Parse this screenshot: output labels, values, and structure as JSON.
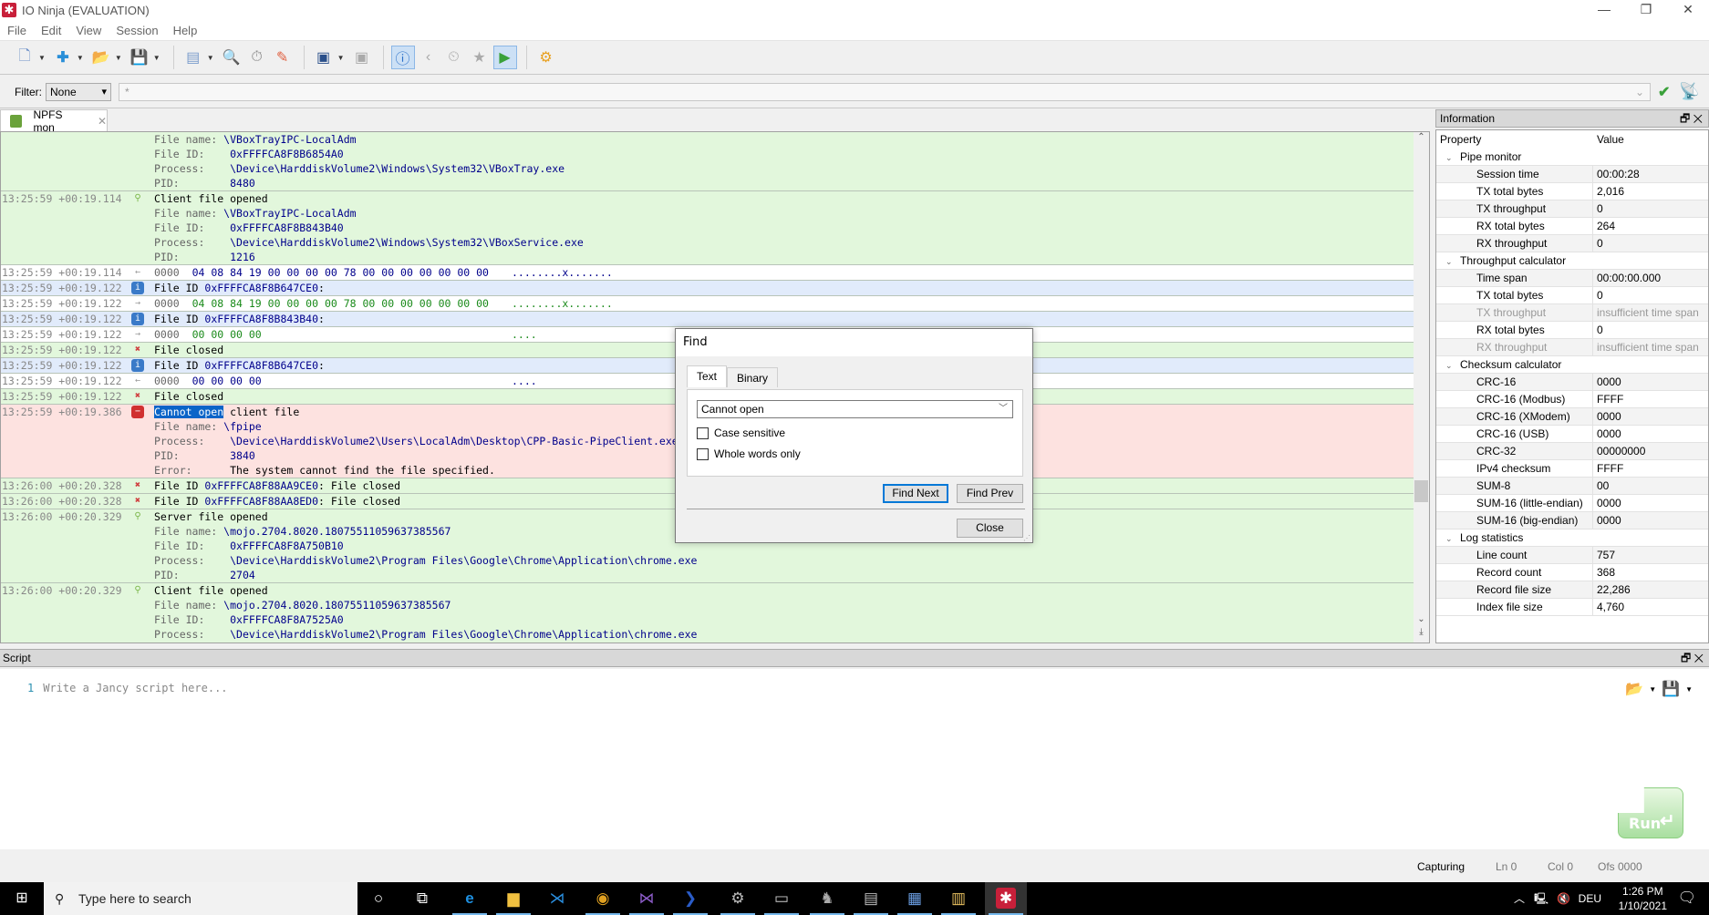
{
  "window": {
    "title": "IO Ninja (EVALUATION)",
    "minimize": "—",
    "restore": "❐",
    "close": "✕"
  },
  "menu": [
    "File",
    "Edit",
    "View",
    "Session",
    "Help"
  ],
  "toolbar": {
    "icons": [
      "new-session-icon",
      "add-icon",
      "open-icon",
      "save-icon",
      "hex-view-icon",
      "find-icon",
      "stopwatch-icon",
      "clear-icon",
      "terminal-icon",
      "terminal-disabled-icon",
      "info-panel-icon",
      "previous-icon",
      "stopwatch-panel-icon",
      "bookmark-icon",
      "play-icon",
      "settings-icon"
    ]
  },
  "filter": {
    "label": "Filter:",
    "mode": "None",
    "value": "*"
  },
  "tabs": [
    {
      "label": "NPFS mon",
      "close": "✕"
    }
  ],
  "log": {
    "rows": [
      {
        "ts": "",
        "icon": "",
        "bg": "green",
        "lines": [
          {
            "k": "File name: ",
            "v": "\\VBoxTrayIPC-LocalAdm"
          },
          {
            "k": "File ID:    ",
            "v": "0xFFFFCA8F8B6854A0"
          },
          {
            "k": "Process:    ",
            "v": "\\Device\\HarddiskVolume2\\Windows\\System32\\VBoxTray.exe"
          },
          {
            "k": "PID:        ",
            "v": "8480"
          }
        ]
      },
      {
        "ts": "13:25:59 +00:19.114",
        "icon": "connect",
        "bg": "green",
        "lines": [
          {
            "t": "Client file opened"
          },
          {
            "k": "File name: ",
            "v": "\\VBoxTrayIPC-LocalAdm"
          },
          {
            "k": "File ID:    ",
            "v": "0xFFFFCA8F8B843B40"
          },
          {
            "k": "Process:    ",
            "v": "\\Device\\HarddiskVolume2\\Windows\\System32\\VBoxService.exe"
          },
          {
            "k": "PID:        ",
            "v": "1216"
          }
        ]
      },
      {
        "ts": "13:25:59 +00:19.114",
        "icon": "rx",
        "bg": "white",
        "lines": [
          {
            "off": "0000",
            "hex": "04 08 84 19 00 00 00 00 78 00 00 00 00 00 00 00",
            "asc": "........x.......",
            "dir": "rx"
          }
        ]
      },
      {
        "ts": "13:25:59 +00:19.122",
        "icon": "info",
        "bg": "blue",
        "lines": [
          {
            "t": "File ID ",
            "v": "0xFFFFCA8F8B647CE0",
            "t2": ":"
          }
        ]
      },
      {
        "ts": "13:25:59 +00:19.122",
        "icon": "tx",
        "bg": "white",
        "lines": [
          {
            "off": "0000",
            "hex": "04 08 84 19 00 00 00 00 78 00 00 00 00 00 00 00",
            "asc": "........x.......",
            "dir": "tx"
          }
        ]
      },
      {
        "ts": "13:25:59 +00:19.122",
        "icon": "info",
        "bg": "blue",
        "lines": [
          {
            "t": "File ID ",
            "v": "0xFFFFCA8F8B843B40",
            "t2": ":"
          }
        ]
      },
      {
        "ts": "13:25:59 +00:19.122",
        "icon": "tx",
        "bg": "white",
        "lines": [
          {
            "off": "0000",
            "hex": "00 00 00 00",
            "asc": "....",
            "dir": "tx"
          }
        ]
      },
      {
        "ts": "13:25:59 +00:19.122",
        "icon": "disconnect",
        "bg": "green",
        "lines": [
          {
            "t": "File closed"
          }
        ]
      },
      {
        "ts": "13:25:59 +00:19.122",
        "icon": "info",
        "bg": "blue",
        "lines": [
          {
            "t": "File ID ",
            "v": "0xFFFFCA8F8B647CE0",
            "t2": ":"
          }
        ]
      },
      {
        "ts": "13:25:59 +00:19.122",
        "icon": "rx",
        "bg": "white",
        "lines": [
          {
            "off": "0000",
            "hex": "00 00 00 00",
            "asc": "....",
            "dir": "rx"
          }
        ]
      },
      {
        "ts": "13:25:59 +00:19.122",
        "icon": "disconnect",
        "bg": "green",
        "lines": [
          {
            "t": "File closed"
          }
        ]
      },
      {
        "ts": "13:25:59 +00:19.386",
        "icon": "error",
        "bg": "red",
        "lines": [
          {
            "sel": "Cannot open",
            "t": " client file"
          },
          {
            "k": "File name: ",
            "v": "\\fpipe"
          },
          {
            "k": "Process:    ",
            "v": "\\Device\\HarddiskVolume2\\Users\\LocalAdm\\Desktop\\CPP-Basic-PipeClient.exe"
          },
          {
            "k": "PID:        ",
            "v": "3840"
          },
          {
            "k": "Error:      ",
            "t": "The system cannot find the file specified."
          }
        ]
      },
      {
        "ts": "13:26:00 +00:20.328",
        "icon": "disconnect",
        "bg": "green",
        "lines": [
          {
            "t": "File ID ",
            "v": "0xFFFFCA8F88AA9CE0",
            "t2": ": File closed"
          }
        ]
      },
      {
        "ts": "13:26:00 +00:20.328",
        "icon": "disconnect",
        "bg": "green",
        "lines": [
          {
            "t": "File ID ",
            "v": "0xFFFFCA8F88AA8ED0",
            "t2": ": File closed"
          }
        ]
      },
      {
        "ts": "13:26:00 +00:20.329",
        "icon": "connect",
        "bg": "green",
        "lines": [
          {
            "t": "Server file opened"
          },
          {
            "k": "File name: ",
            "v": "\\mojo.2704.8020.18075511059637385567"
          },
          {
            "k": "File ID:    ",
            "v": "0xFFFFCA8F8A750B10"
          },
          {
            "k": "Process:    ",
            "v": "\\Device\\HarddiskVolume2\\Program Files\\Google\\Chrome\\Application\\chrome.exe"
          },
          {
            "k": "PID:        ",
            "v": "2704"
          }
        ]
      },
      {
        "ts": "13:26:00 +00:20.329",
        "icon": "connect",
        "bg": "green",
        "lines": [
          {
            "t": "Client file opened"
          },
          {
            "k": "File name: ",
            "v": "\\mojo.2704.8020.18075511059637385567"
          },
          {
            "k": "File ID:    ",
            "v": "0xFFFFCA8F8A7525A0"
          },
          {
            "k": "Process:    ",
            "v": "\\Device\\HarddiskVolume2\\Program Files\\Google\\Chrome\\Application\\chrome.exe"
          },
          {
            "k": "PID:        ",
            "v": "2704"
          }
        ]
      }
    ]
  },
  "info_panel": {
    "title": "Information",
    "col_property": "Property",
    "col_value": "Value",
    "groups": [
      {
        "name": "Pipe monitor",
        "items": [
          {
            "p": "Session time",
            "v": "00:00:28"
          },
          {
            "p": "TX total bytes",
            "v": "2,016"
          },
          {
            "p": "TX throughput",
            "v": "0"
          },
          {
            "p": "RX total bytes",
            "v": "264"
          },
          {
            "p": "RX throughput",
            "v": "0"
          }
        ]
      },
      {
        "name": "Throughput calculator",
        "items": [
          {
            "p": "Time span",
            "v": "00:00:00.000"
          },
          {
            "p": "TX total bytes",
            "v": "0"
          },
          {
            "p": "TX throughput",
            "v": "insufficient time span",
            "dim": true
          },
          {
            "p": "RX total bytes",
            "v": "0"
          },
          {
            "p": "RX throughput",
            "v": "insufficient time span",
            "dim": true
          }
        ]
      },
      {
        "name": "Checksum calculator",
        "items": [
          {
            "p": "CRC-16",
            "v": "0000"
          },
          {
            "p": "CRC-16 (Modbus)",
            "v": "FFFF"
          },
          {
            "p": "CRC-16 (XModem)",
            "v": "0000"
          },
          {
            "p": "CRC-16 (USB)",
            "v": "0000"
          },
          {
            "p": "CRC-32",
            "v": "00000000"
          },
          {
            "p": "IPv4 checksum",
            "v": "FFFF"
          },
          {
            "p": "SUM-8",
            "v": "00"
          },
          {
            "p": "SUM-16 (little-endian)",
            "v": "0000"
          },
          {
            "p": "SUM-16 (big-endian)",
            "v": "0000"
          }
        ]
      },
      {
        "name": "Log statistics",
        "items": [
          {
            "p": "Line count",
            "v": "757"
          },
          {
            "p": "Record count",
            "v": "368"
          },
          {
            "p": "Record file size",
            "v": "22,286"
          },
          {
            "p": "Index file size",
            "v": "4,760"
          }
        ]
      }
    ]
  },
  "script": {
    "title": "Script",
    "line_no": "1",
    "placeholder": "Write a Jancy script here...",
    "run_label": "Run"
  },
  "status": {
    "state": "Capturing",
    "ln": "Ln 0",
    "col": "Col 0",
    "ofs": "Ofs 0000"
  },
  "find_dialog": {
    "title": "Find",
    "tabs": [
      "Text",
      "Binary"
    ],
    "query": "Cannot open",
    "case_sensitive": {
      "label": "Case sensitive",
      "checked": false
    },
    "whole_words": {
      "label": "Whole words only",
      "checked": false
    },
    "find_next": "Find Next",
    "find_prev": "Find Prev",
    "close": "Close"
  },
  "taskbar": {
    "search_placeholder": "Type here to search",
    "apps": [
      "cortana",
      "task-view",
      "edge",
      "file-explorer",
      "vscode",
      "chrome",
      "visual-studio",
      "powershell",
      "network-tool",
      "terminal",
      "app-spy",
      "monitor",
      "devices",
      "notepad",
      "io-ninja"
    ],
    "tray": {
      "lang": "DEU",
      "time": "1:26 PM",
      "date": "1/10/2021"
    }
  },
  "colors": {
    "accent": "#c8203a",
    "selection": "#0a64c8",
    "row_green": "#e2f7dc",
    "row_blue": "#e1ebfb",
    "row_red": "#fde2e0"
  }
}
